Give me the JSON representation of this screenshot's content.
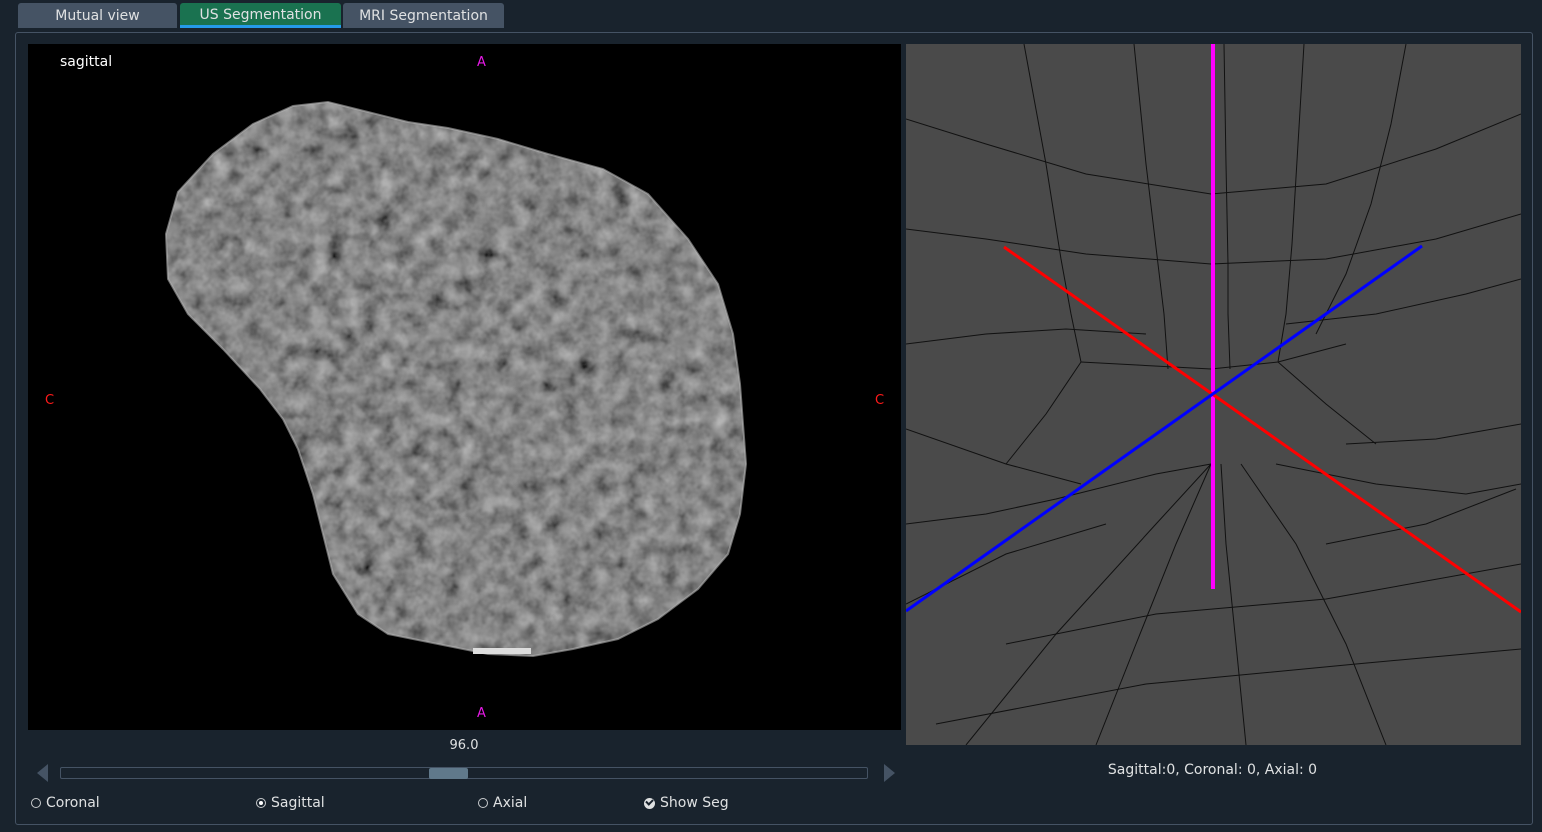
{
  "tabs": [
    {
      "label": "Mutual view",
      "active": false
    },
    {
      "label": "US Segmentation",
      "active": true
    },
    {
      "label": "MRI Segmentation",
      "active": false
    }
  ],
  "slice_view": {
    "view_name": "sagittal",
    "orientation": {
      "top": "A",
      "bottom": "A",
      "left": "C",
      "right": "C"
    }
  },
  "slider": {
    "value": "96.0",
    "position_fraction": 0.48
  },
  "view_options": {
    "coronal": "Coronal",
    "sagittal": "Sagittal",
    "axial": "Axial",
    "selected": "Sagittal",
    "show_seg": "Show Seg",
    "show_seg_checked": true
  },
  "view_3d": {
    "coords": "Sagittal:0, Coronal: 0, Axial: 0"
  },
  "colors": {
    "accent": "#1a7250",
    "tab_inactive": "#455364",
    "background": "#19232d",
    "axis_magenta": "#ff00ff",
    "axis_red": "#ff0000",
    "axis_blue": "#0000ff",
    "view3d_background": "#4a4a4a"
  },
  "icons": {
    "slider_left": "left-arrow-icon",
    "slider_right": "right-arrow-icon"
  }
}
